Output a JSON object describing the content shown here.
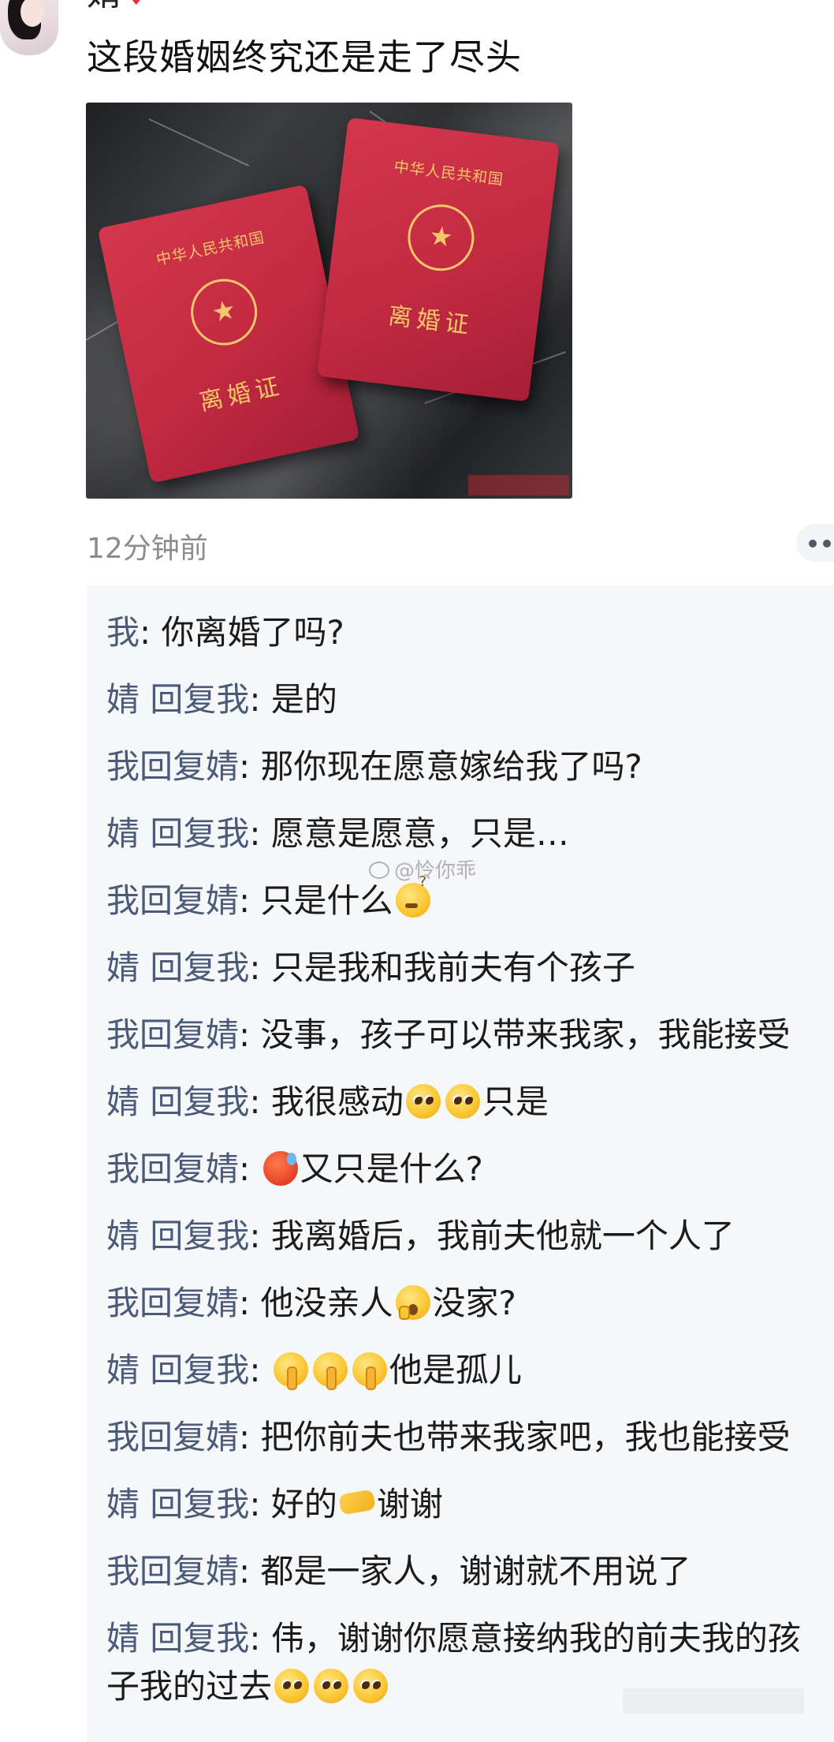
{
  "post": {
    "username": "婧",
    "text": "这段婚姻终究还是走了尽头",
    "image": {
      "book_country": "中华人民共和国",
      "book_title": "离婚证"
    },
    "timestamp": "12分钟前"
  },
  "comments": [
    {
      "name": "我",
      "sep": ": ",
      "text": "你离婚了吗?"
    },
    {
      "name": "婧 回复我",
      "sep": ": ",
      "text": "是的"
    },
    {
      "name": "我回复婧",
      "sep": ": ",
      "text": "那你现在愿意嫁给我了吗?"
    },
    {
      "name": "婧 回复我",
      "sep": ": ",
      "text": "愿意是愿意，只是…"
    },
    {
      "name": "我回复婧",
      "sep": ": ",
      "text": "只是什么"
    },
    {
      "name": "婧 回复我",
      "sep": ": ",
      "text": "只是我和我前夫有个孩子"
    },
    {
      "name": "我回复婧",
      "sep": ": ",
      "text": "没事，孩子可以带来我家，我能接受"
    },
    {
      "name": "婧 回复我",
      "sep": ": ",
      "text_a": "我很感动",
      "text_b": "只是"
    },
    {
      "name": "我回复婧",
      "sep": ": ",
      "text": "又只是什么?"
    },
    {
      "name": "婧 回复我",
      "sep": ": ",
      "text": "我离婚后，我前夫他就一个人了"
    },
    {
      "name": "我回复婧",
      "sep": ": ",
      "text_a": "他没亲人",
      "text_b": "没家?"
    },
    {
      "name": "婧 回复我",
      "sep": ": ",
      "text": "他是孤儿"
    },
    {
      "name": "我回复婧",
      "sep": ": ",
      "text": "把你前夫也带来我家吧，我也能接受"
    },
    {
      "name": "婧 回复我",
      "sep": ": ",
      "text_a": "好的",
      "text_b": "谢谢"
    },
    {
      "name": "我回复婧",
      "sep": ": ",
      "text": "都是一家人，谢谢就不用说了"
    },
    {
      "name": "婧 回复我",
      "sep": ": ",
      "text": "伟，谢谢你愿意接纳我的前夫我的孩子我的过去"
    }
  ],
  "watermark": "@怜你乖",
  "icons": {
    "more": "more-dots-icon",
    "weibo": "weibo-logo-icon"
  }
}
